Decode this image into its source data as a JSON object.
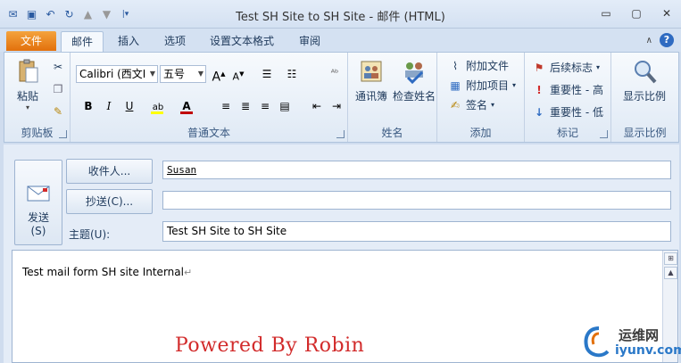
{
  "window": {
    "title": "Test SH Site to SH Site  -  邮件 (HTML)"
  },
  "qat": {
    "icons": [
      "outlook-icon",
      "save-icon",
      "undo-icon",
      "redo-icon",
      "up-icon",
      "down-icon",
      "customize-icon"
    ]
  },
  "tabs": {
    "file": "文件",
    "items": [
      "邮件",
      "插入",
      "选项",
      "设置文本格式",
      "审阅"
    ]
  },
  "ribbon": {
    "clipboard": {
      "paste": "粘贴",
      "label": "剪贴板"
    },
    "basic_text": {
      "font": "Calibri (西文I",
      "size": "五号",
      "label": "普通文本"
    },
    "names": {
      "address_book": "通讯簿",
      "check_names": "检查姓名",
      "label": "姓名"
    },
    "include": {
      "attach_file": "附加文件",
      "attach_item": "附加项目",
      "signature": "签名",
      "label": "添加"
    },
    "tags": {
      "follow_up": "后续标志",
      "high": "重要性 - 高",
      "low": "重要性 - 低",
      "label": "标记"
    },
    "zoom": {
      "zoom": "显示比例",
      "label": "显示比例"
    }
  },
  "compose": {
    "send": "发送",
    "send_key": "(S)",
    "to_button": "收件人...",
    "cc_button": "抄送(C)...",
    "subject_label": "主题(U):",
    "to_value": "Susan",
    "cc_value": "",
    "subject_value": "Test SH Site to SH Site",
    "body_text": "Test mail form SH site Internal"
  },
  "overlay": {
    "watermark": "Powered By Robin",
    "logo_cn": "运维网",
    "logo_url": "iyunv.com"
  },
  "colors": {
    "file_tab": "#e2700c",
    "watermark": "#d22b2b",
    "highlight": "#ffff00",
    "font_color": "#c00000"
  }
}
